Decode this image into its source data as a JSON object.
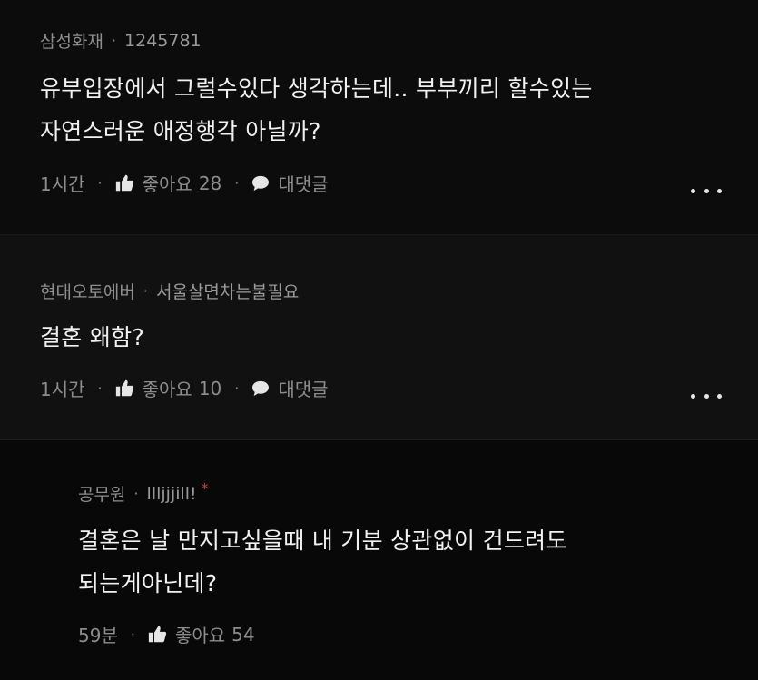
{
  "comments": [
    {
      "author": "삼성화재",
      "nickname": "1245781",
      "lines": [
        "유부입장에서 그럴수있다 생각하는데.. 부부끼리 할수있는",
        "자연스러운 애정행각 아닐까?"
      ],
      "time": "1시간",
      "like_label": "좋아요",
      "like_count": "28",
      "reply_label": "대댓글"
    },
    {
      "author": "현대오토에버",
      "nickname": "서울살면차는불필요",
      "lines": [
        "결혼 왜함?"
      ],
      "time": "1시간",
      "like_label": "좋아요",
      "like_count": "10",
      "reply_label": "대댓글"
    },
    {
      "author": "공무원",
      "nickname": "llljjjill!",
      "author_marker": "*",
      "lines": [
        "결혼은 날 만지고싶을때 내 기분 상관없이 건드려도",
        "되는게아닌데?"
      ],
      "time": "59분",
      "like_label": "좋아요",
      "like_count": "54"
    }
  ],
  "separator": "·",
  "icons": {
    "like": "thumbs-up-icon",
    "reply": "speech-bubble-icon",
    "more": "more-options-icon"
  },
  "colors": {
    "background": "#0b0b0b",
    "text": "#f1f1f1",
    "meta": "#8c8c8c",
    "marker": "#e0384a"
  }
}
